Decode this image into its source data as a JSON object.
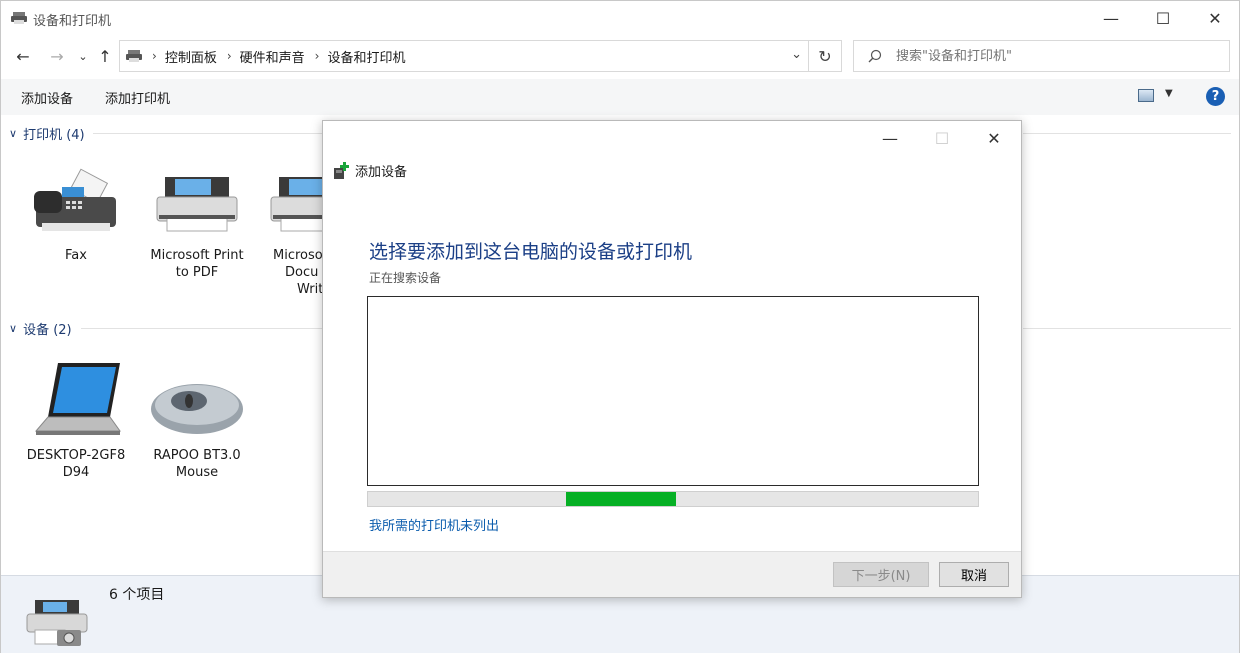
{
  "window": {
    "title": "设备和打印机"
  },
  "nav": {
    "breadcrumbs": [
      "控制面板",
      "硬件和声音",
      "设备和打印机"
    ],
    "search_placeholder": "搜索\"设备和打印机\""
  },
  "commands": {
    "add_device": "添加设备",
    "add_printer": "添加打印机"
  },
  "groups": {
    "printers": {
      "header": "打印机 (4)",
      "items": [
        {
          "line1": "Fax",
          "line2": ""
        },
        {
          "line1": "Microsoft Print",
          "line2": "to PDF"
        },
        {
          "line1": "Microso",
          "line2": "Docu",
          "line3": "Writ"
        }
      ]
    },
    "devices": {
      "header": "设备 (2)",
      "items": [
        {
          "line1": "DESKTOP-2GF8",
          "line2": "D94"
        },
        {
          "line1": "RAPOO BT3.0",
          "line2": "Mouse"
        }
      ]
    }
  },
  "details": {
    "count": "6 个项目"
  },
  "dialog": {
    "title": "添加设备",
    "heading": "选择要添加到这台电脑的设备或打印机",
    "status": "正在搜索设备",
    "link": "我所需的打印机未列出",
    "next": "下一步(N)",
    "cancel": "取消",
    "progress_fraction": 0.18
  },
  "colors": {
    "accent": "#1b3f86",
    "link": "#0b5cad",
    "progress": "#06b025"
  }
}
